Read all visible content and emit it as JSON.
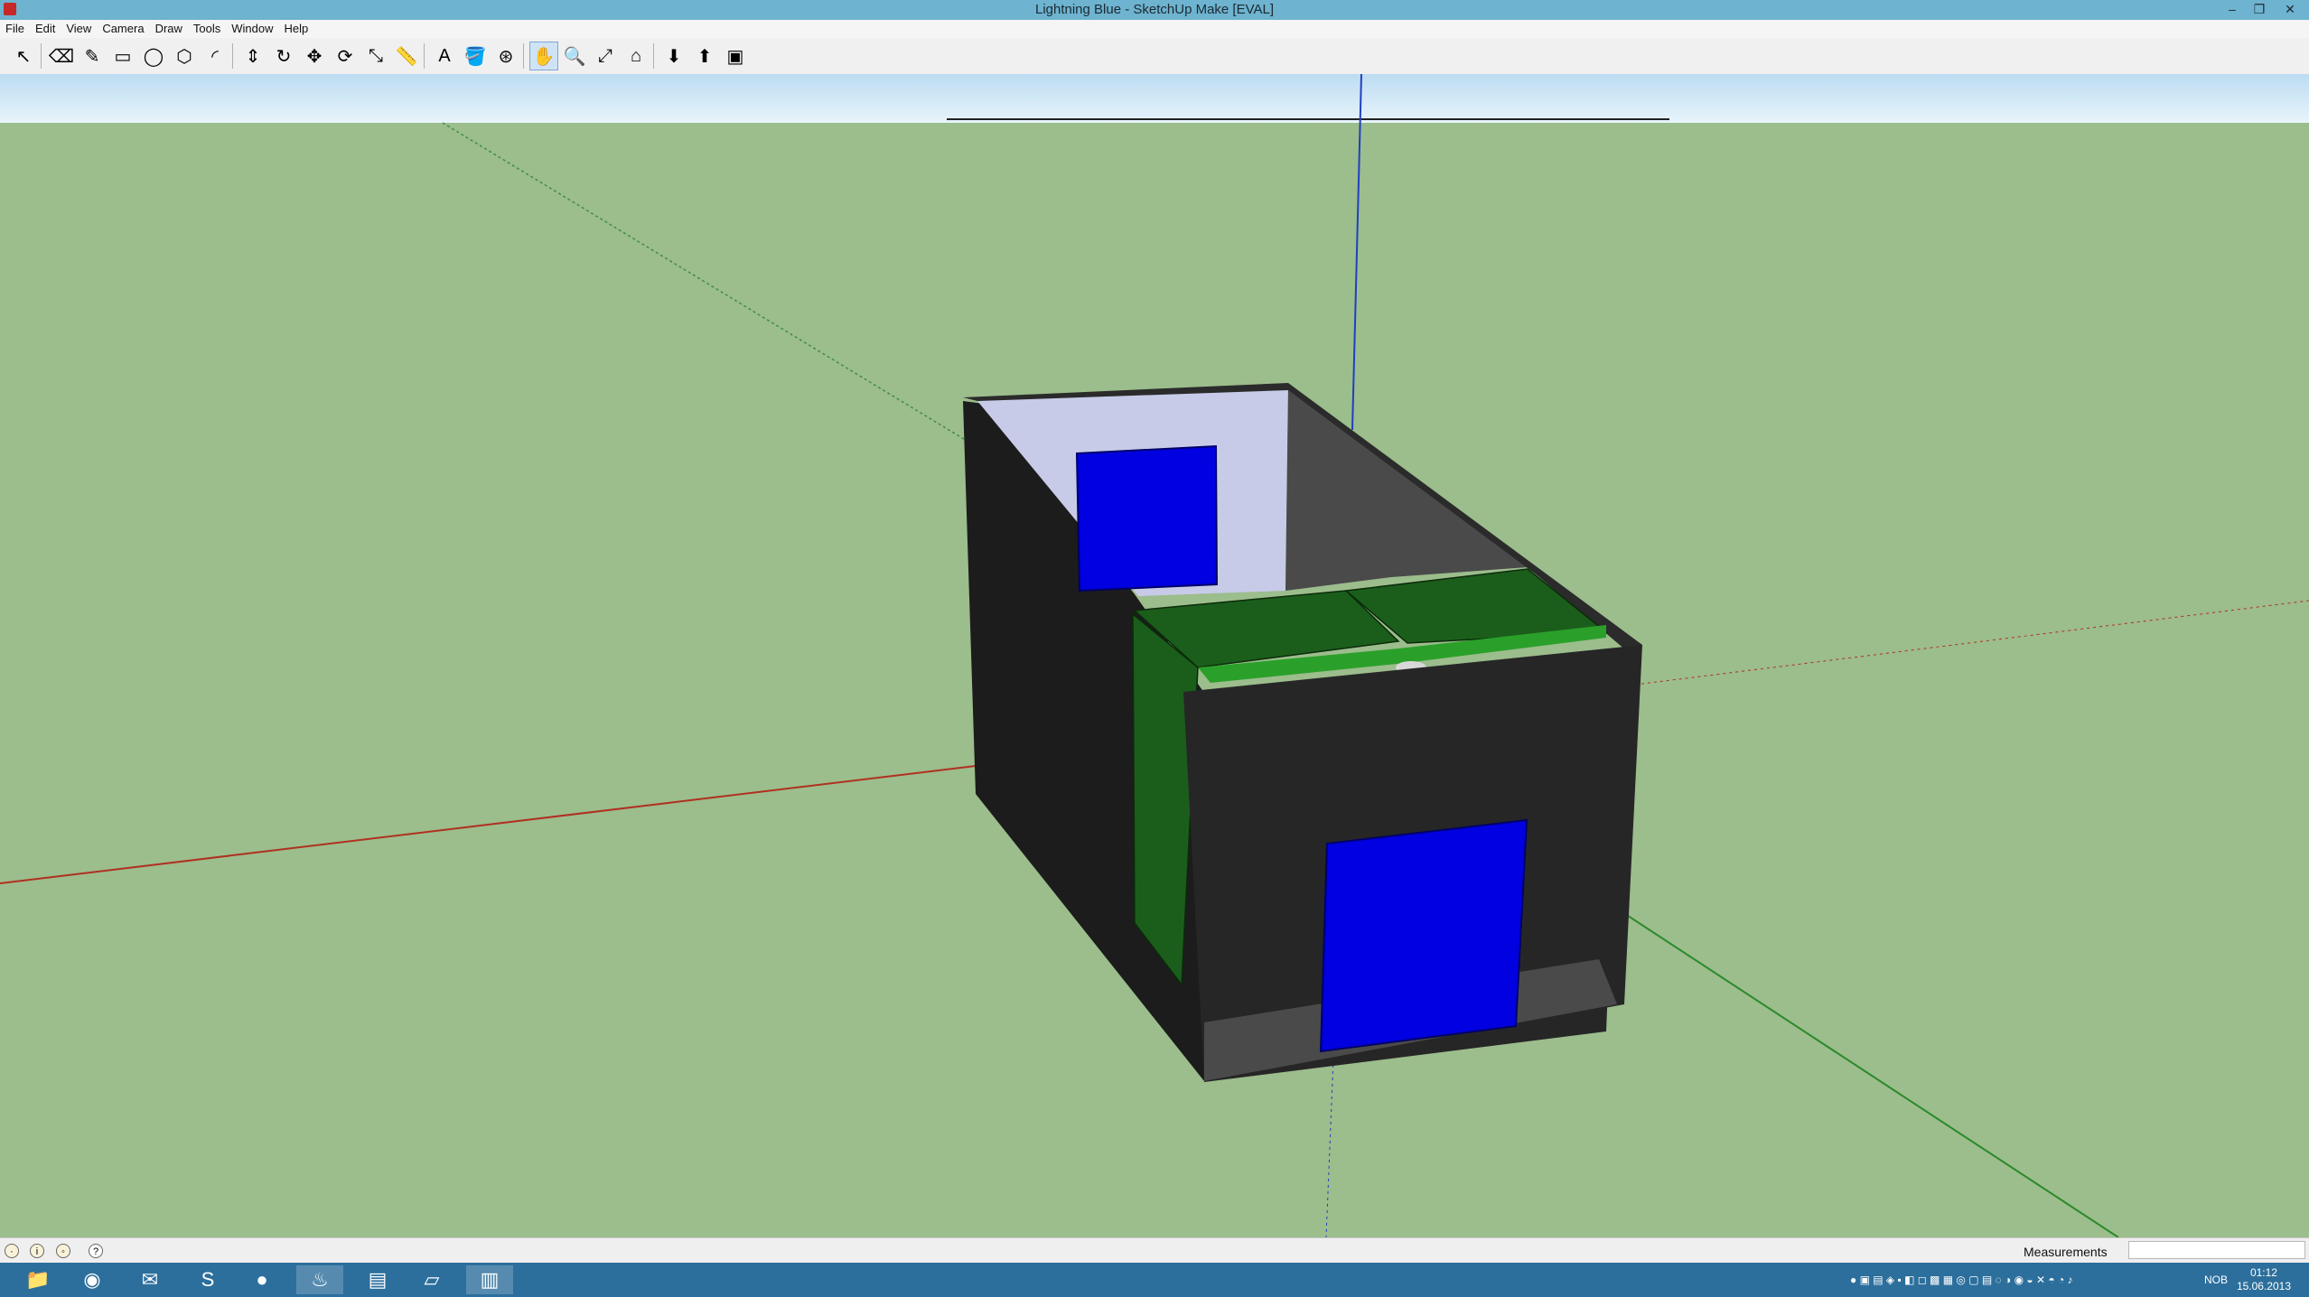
{
  "window": {
    "title": "Lightning Blue - SketchUp Make [EVAL]"
  },
  "menu": {
    "items": [
      "File",
      "Edit",
      "View",
      "Camera",
      "Draw",
      "Tools",
      "Window",
      "Help"
    ]
  },
  "toolbar": {
    "tools": [
      {
        "name": "select-tool",
        "icon": "arrow-icon",
        "glyph": "↖"
      },
      {
        "name": "eraser-tool",
        "icon": "eraser-icon",
        "glyph": "⌫"
      },
      {
        "name": "pencil-tool",
        "icon": "pencil-icon",
        "glyph": "✎"
      },
      {
        "name": "rectangle-tool",
        "icon": "rectangle-icon",
        "glyph": "▭"
      },
      {
        "name": "circle-tool",
        "icon": "circle-icon",
        "glyph": "◯"
      },
      {
        "name": "polygon-tool",
        "icon": "polygon-icon",
        "glyph": "⬡"
      },
      {
        "name": "arc-tool",
        "icon": "arc-icon",
        "glyph": "◜"
      },
      {
        "name": "push-pull-tool",
        "icon": "push-pull-icon",
        "glyph": "⇕"
      },
      {
        "name": "follow-me-tool",
        "icon": "follow-me-icon",
        "glyph": "↻"
      },
      {
        "name": "move-tool",
        "icon": "move-icon",
        "glyph": "✥"
      },
      {
        "name": "rotate-tool",
        "icon": "rotate-icon",
        "glyph": "⟳"
      },
      {
        "name": "scale-tool",
        "icon": "scale-icon",
        "glyph": "⤡"
      },
      {
        "name": "tape-measure-tool",
        "icon": "tape-measure-icon",
        "glyph": "📏"
      },
      {
        "name": "text-tool",
        "icon": "text-icon",
        "glyph": "A"
      },
      {
        "name": "paint-bucket-tool",
        "icon": "paint-bucket-icon",
        "glyph": "🪣"
      },
      {
        "name": "orbit-tool",
        "icon": "orbit-icon",
        "glyph": "⊛"
      },
      {
        "name": "pan-tool",
        "icon": "pan-icon",
        "glyph": "✋"
      },
      {
        "name": "zoom-tool",
        "icon": "zoom-icon",
        "glyph": "🔍"
      },
      {
        "name": "zoom-extents-tool",
        "icon": "zoom-extents-icon",
        "glyph": "⤢"
      },
      {
        "name": "warehouse-tool",
        "icon": "warehouse-icon",
        "glyph": "⌂"
      },
      {
        "name": "get-models-tool",
        "icon": "get-models-icon",
        "glyph": "⬇"
      },
      {
        "name": "share-model-tool",
        "icon": "share-model-icon",
        "glyph": "⬆"
      },
      {
        "name": "extension-tool",
        "icon": "extension-icon",
        "glyph": "▣"
      }
    ],
    "active_tool": "pan-tool"
  },
  "status": {
    "measurements_label": "Measurements",
    "measurements_value": ""
  },
  "taskbar": {
    "apps": [
      "file-explorer",
      "chrome",
      "thunderbird",
      "skype",
      "firefox",
      "steam",
      "network",
      "notes",
      "sketchup"
    ],
    "language": "NOB",
    "time": "01:12",
    "date": "15.06.2013"
  },
  "colors": {
    "ground": "#9cbd8c",
    "sky": "#d8ecf8",
    "box_dark": "#1f1f1f",
    "box_mid": "#262626",
    "panel_blue": "#0000e0",
    "green_top": "#1b5e1b",
    "green_light": "#2aa02a",
    "interior": "#c7cbe8"
  }
}
